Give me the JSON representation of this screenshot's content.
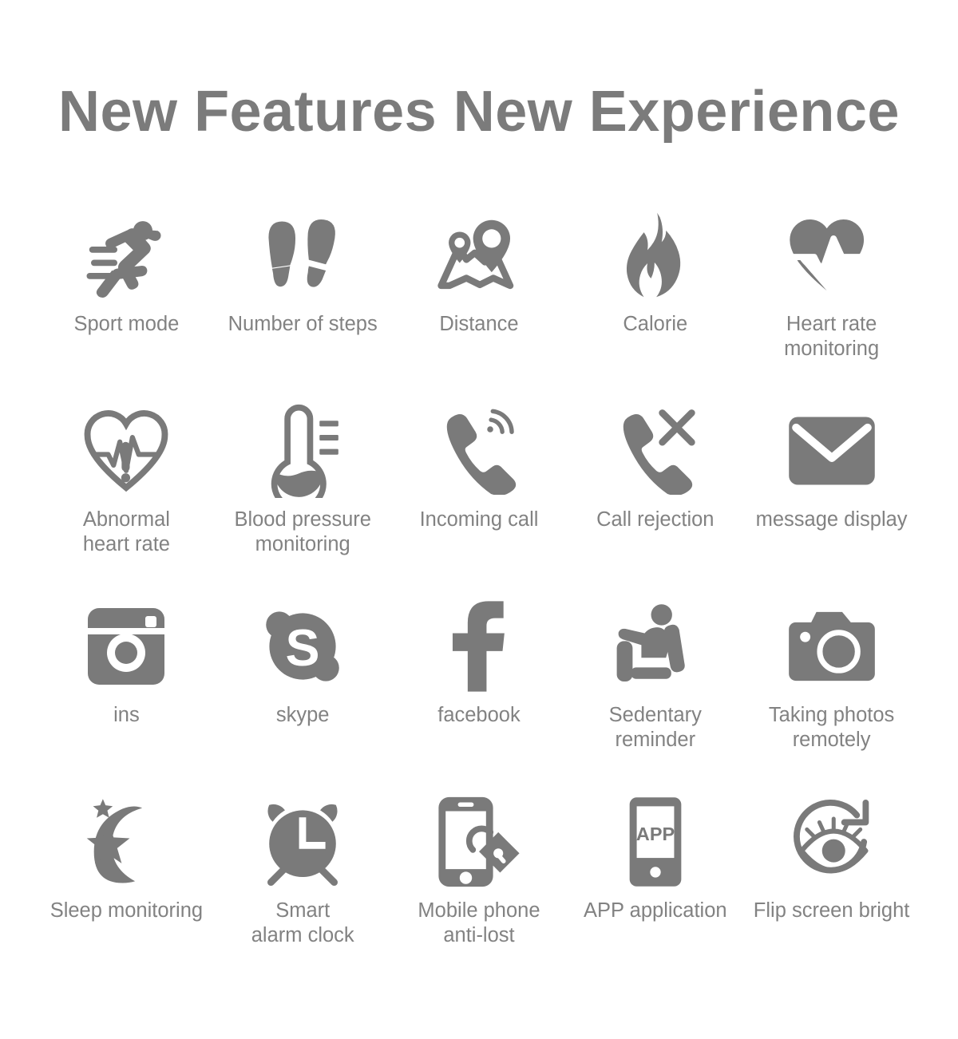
{
  "header": {
    "title": "New Features New Experience"
  },
  "theme": {
    "background": "#ffffff",
    "icon_color": "#7a7a7a",
    "title_color": "#7b7b7b",
    "label_color": "#828282"
  },
  "features": [
    {
      "icon": "running-figure-icon",
      "label": "Sport mode"
    },
    {
      "icon": "footprints-icon",
      "label": "Number of steps"
    },
    {
      "icon": "map-pins-icon",
      "label": "Distance"
    },
    {
      "icon": "flame-icon",
      "label": "Calorie"
    },
    {
      "icon": "heart-pulse-filled-icon",
      "label": "Heart rate\nmonitoring"
    },
    {
      "icon": "heart-pulse-outline-alert-icon",
      "label": "Abnormal\nheart rate"
    },
    {
      "icon": "thermometer-icon",
      "label": "Blood pressure\nmonitoring"
    },
    {
      "icon": "phone-incoming-icon",
      "label": "Incoming call"
    },
    {
      "icon": "phone-reject-icon",
      "label": "Call rejection"
    },
    {
      "icon": "envelope-icon",
      "label": "message display"
    },
    {
      "icon": "instagram-icon",
      "label": "ins"
    },
    {
      "icon": "skype-icon",
      "label": "skype"
    },
    {
      "icon": "facebook-icon",
      "label": "facebook"
    },
    {
      "icon": "seated-person-icon",
      "label": "Sedentary\nreminder"
    },
    {
      "icon": "camera-icon",
      "label": "Taking photos\nremotely"
    },
    {
      "icon": "moon-stars-icon",
      "label": "Sleep monitoring"
    },
    {
      "icon": "alarm-clock-icon",
      "label": "Smart\nalarm clock"
    },
    {
      "icon": "phone-lock-icon",
      "label": "Mobile phone\nanti-lost"
    },
    {
      "icon": "phone-app-icon",
      "label": "APP application"
    },
    {
      "icon": "eye-rotate-icon",
      "label": "Flip screen bright"
    }
  ],
  "icon_text": {
    "app_badge": "APP",
    "alarm_hand": "L",
    "facebook_glyph": "f",
    "skype_glyph": "S"
  }
}
